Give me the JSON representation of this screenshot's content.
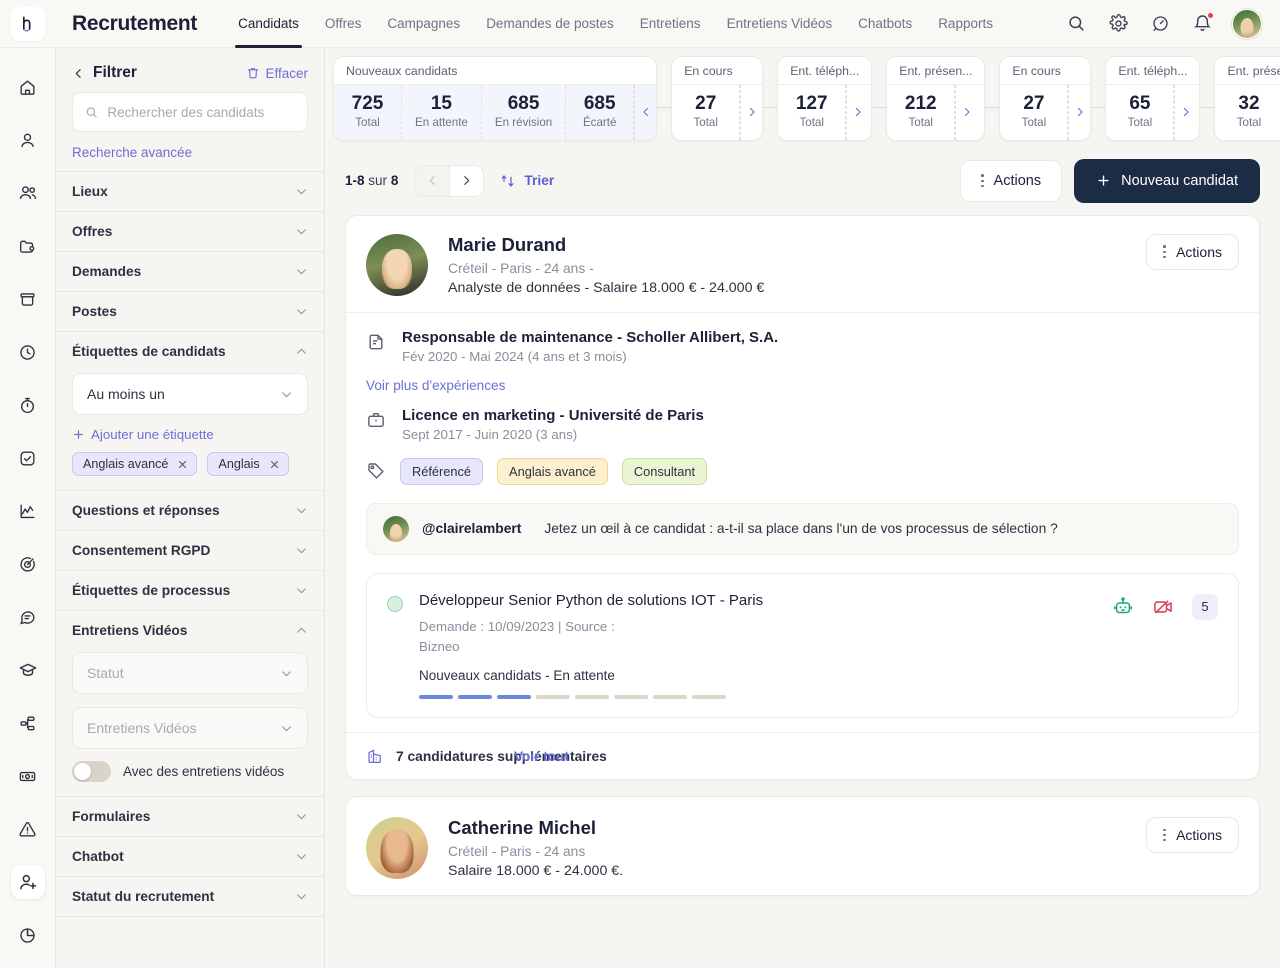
{
  "topbar": {
    "brand": "Recrutement",
    "nav": [
      {
        "label": "Candidats",
        "active": true
      },
      {
        "label": "Offres",
        "active": false
      },
      {
        "label": "Campagnes",
        "active": false
      },
      {
        "label": "Demandes de postes",
        "active": false
      },
      {
        "label": "Entretiens",
        "active": false
      },
      {
        "label": "Entretiens Vidéos",
        "active": false
      },
      {
        "label": "Chatbots",
        "active": false
      },
      {
        "label": "Rapports",
        "active": false
      }
    ],
    "icons": [
      "search-icon",
      "gear-icon",
      "speedometer-icon",
      "bell-icon"
    ],
    "notification_dot_color": "#e8453c"
  },
  "rail": {
    "items": [
      "home-icon",
      "user-icon",
      "users-icon",
      "folder-icon",
      "archive-icon",
      "clock-icon",
      "stopwatch-icon",
      "check-square-icon",
      "chart-line-icon",
      "target-icon",
      "chat-bubble-icon",
      "graduation-cap-icon",
      "workflow-icon",
      "money-icon",
      "alert-triangle-icon",
      "user-plus-icon",
      "pie-chart-icon"
    ],
    "active_index": 15
  },
  "filters": {
    "title": "Filtrer",
    "clear_label": "Effacer",
    "search_placeholder": "Rechercher des candidats",
    "search_value": "",
    "advanced_search": "Recherche avancée",
    "sections": [
      {
        "label": "Lieux",
        "open": false
      },
      {
        "label": "Offres",
        "open": false
      },
      {
        "label": "Demandes",
        "open": false
      },
      {
        "label": "Postes",
        "open": false
      },
      {
        "label": "Étiquettes de candidats",
        "open": true
      },
      {
        "label": "Questions et réponses",
        "open": false
      },
      {
        "label": "Consentement RGPD",
        "open": false
      },
      {
        "label": "Étiquettes de processus",
        "open": false
      },
      {
        "label": "Entretiens Vidéos",
        "open": true
      },
      {
        "label": "Formulaires",
        "open": false
      },
      {
        "label": "Chatbot",
        "open": false
      },
      {
        "label": "Statut du recrutement",
        "open": false
      }
    ],
    "tags_select_value": "Au moins un",
    "add_tag_label": "Ajouter une étiquette",
    "tag_chips": [
      "Anglais avancé",
      "Anglais"
    ],
    "video_status_placeholder": "Statut",
    "video_interviews_placeholder": "Entretiens Vidéos",
    "video_toggle_label": "Avec des entretiens vidéos",
    "video_toggle_on": false
  },
  "stages": [
    {
      "title": "Nouveaux candidats",
      "active": true,
      "metrics": [
        {
          "num": "725",
          "lab": "Total"
        },
        {
          "num": "15",
          "lab": "En attente"
        },
        {
          "num": "685",
          "lab": "En révision"
        },
        {
          "num": "685",
          "lab": "Écarté"
        }
      ],
      "arrow": "chevron-left-icon"
    },
    {
      "title": "En cours",
      "active": false,
      "metrics": [
        {
          "num": "27",
          "lab": "Total"
        }
      ],
      "arrow": "chevron-right-icon"
    },
    {
      "title": "Ent. téléph...",
      "active": false,
      "metrics": [
        {
          "num": "127",
          "lab": "Total"
        }
      ],
      "arrow": "chevron-right-icon"
    },
    {
      "title": "Ent. présen...",
      "active": false,
      "metrics": [
        {
          "num": "212",
          "lab": "Total"
        }
      ],
      "arrow": "chevron-right-icon"
    },
    {
      "title": "En cours",
      "active": false,
      "metrics": [
        {
          "num": "27",
          "lab": "Total"
        }
      ],
      "arrow": "chevron-right-icon"
    },
    {
      "title": "Ent. téléph...",
      "active": false,
      "metrics": [
        {
          "num": "65",
          "lab": "Total"
        }
      ],
      "arrow": "chevron-right-icon"
    },
    {
      "title": "Ent. présen...",
      "active": false,
      "metrics": [
        {
          "num": "32",
          "lab": "Total"
        }
      ],
      "arrow": "chevron-right-icon"
    }
  ],
  "toolbar": {
    "range": "1-8",
    "sur": "sur",
    "total": "8",
    "sort_label": "Trier",
    "actions_label": "Actions",
    "new_candidate_label": "Nouveau candidat"
  },
  "candidates": [
    {
      "name": "Marie Durand",
      "meta": "Créteil - Paris - 24 ans -",
      "role": "Analyste de données - Salaire 18.000 € - 24.000 €",
      "actions_label": "Actions",
      "experience": {
        "title": "Responsable de maintenance - Scholler Allibert, S.A.",
        "sub": "Fév 2020 - Mai 2024 (4 ans et 3 mois)"
      },
      "more_experiences": "Voir plus d'expériences",
      "education": {
        "title": "Licence en marketing - Université de Paris",
        "sub": "Sept 2017 - Juin 2020 (3 ans)"
      },
      "tags": [
        {
          "label": "Référencé",
          "color": "purple"
        },
        {
          "label": "Anglais avancé",
          "color": "yellow"
        },
        {
          "label": "Consultant",
          "color": "green"
        }
      ],
      "note": {
        "user": "@clairelambert",
        "text": "Jetez un œil à ce candidat : a-t-il sa place dans l'un de vos processus de sélection ?"
      },
      "process": {
        "title": "Développeur Senior Python de solutions IOT - Paris",
        "sub": "Demande : 10/09/2023 | Source : Bizneo",
        "stage": "Nouveaux candidats - En attente",
        "steps_total": 8,
        "steps_done": 3,
        "count_badge": "5",
        "icons": [
          "robot-icon",
          "video-off-icon"
        ]
      },
      "more_applications": "7 candidatures supplémentaires",
      "more_applications_link": "Voir tout"
    },
    {
      "name": "Catherine Michel",
      "meta": "Créteil - Paris - 24 ans",
      "role": "Salaire 18.000 € - 24.000 €.",
      "actions_label": "Actions"
    }
  ],
  "colors": {
    "accent": "#6c6fd6",
    "primary_button": "#1c2c45",
    "page_bg": "#f7f5f2",
    "card_bg": "#ffffff",
    "stage_active_bg": "#f3f5fd",
    "step_done": "#6d8ada"
  }
}
